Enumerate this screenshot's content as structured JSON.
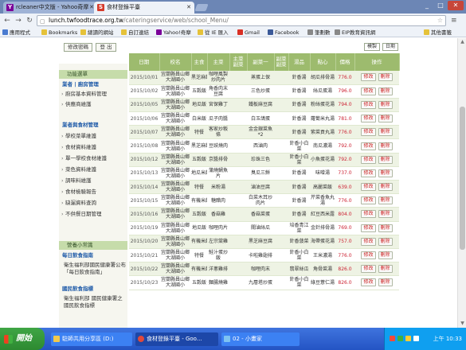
{
  "browser": {
    "tabs": [
      {
        "label": "rcleaner中文版 - Yahoo奇摩",
        "favicon": "Y"
      },
      {
        "label": "食材登錄平臺",
        "favicon": "S"
      }
    ],
    "url_host": "lunch.twfoodtrace.org.tw",
    "url_path": "/cateringservice/web/school_Menu/",
    "bookmarks": [
      "應用程式",
      "Bookmarks",
      "總讀的網站",
      "自訂連結",
      "Yahoo!奇摩",
      "從 IE 匯入",
      "Gmail",
      "Facebook",
      "筆劃數",
      "EIP教育資訊網",
      "其他書籤"
    ]
  },
  "page": {
    "top_buttons": [
      "修改密碼",
      "登 出"
    ],
    "table_buttons": [
      "模製",
      "日期"
    ],
    "sidebar": {
      "header": "功能選單",
      "cat1": "業者 | 廚房管理",
      "cat1_items": [
        "廚房基本資料管理",
        "供應商維護"
      ],
      "cat2": "業者與食材管理",
      "cat2_items": [
        "學校菜單維護",
        "食材資料維護",
        "單一學校食材維護",
        "菜色資料維護",
        "調味料維護",
        "食材檢驗報告",
        "缺漏資料查詢",
        "不供餐日期管理"
      ],
      "tips_header": "營養小常識",
      "tip1_title": "每日飲食指南",
      "tip1_text": "衛生福利部國民健康署公布「每日飲食指南」",
      "tip2_title": "國民飲食指標",
      "tip2_text": "衛生福利部 國民健康署之國民飲食指標"
    },
    "table": {
      "headers": [
        "日期",
        "校名",
        "主食",
        "主菜",
        "主菜 副菜",
        "副菜一",
        "副菜 副菜",
        "湯品",
        "點心",
        "價格",
        "操作"
      ],
      "rows": [
        [
          "2015/10/01",
          "宜蘭縣員山鄉大湖國小",
          "黑芝麻飯",
          "咖哩風製炒肉片",
          "",
          "蒸蛋上保",
          "",
          "針香湯",
          "胡瓜排骨湯",
          "776.0"
        ],
        [
          "2015/10/02",
          "宜蘭縣員山鄉大湖國小",
          "五穀飯",
          "角香肉末豆腐",
          "",
          "三色炒蛋",
          "",
          "針香湯",
          "絲瓜蛋湯",
          "796.0"
        ],
        [
          "2015/10/05",
          "宜蘭縣員山鄉大湖國小",
          "地瓜飯",
          "宮保雞丁",
          "",
          "鐵板麻豆腐",
          "",
          "針香湯",
          "粉絲蛋花湯",
          "794.0"
        ],
        [
          "2015/10/06",
          "宜蘭縣員山鄉大湖國小",
          "白米飯",
          "瓜子肉醬",
          "",
          "白玉鴿蛋",
          "",
          "針香湯",
          "蘿蔔米丸湯",
          "781.0"
        ],
        [
          "2015/10/07",
          "宜蘭縣員山鄉大湖國小",
          "特餐",
          "客家炒粄條",
          "",
          "金金銀菜魚*2",
          "",
          "針香湯",
          "紫菜貢丸湯",
          "776.0"
        ],
        [
          "2015/10/08",
          "宜蘭縣員山鄉大湖國小",
          "黑芝麻飯",
          "豆豉燒肉",
          "",
          "西滷肉",
          "",
          "針香小白菜",
          "南瓜濃湯",
          "792.0"
        ],
        [
          "2015/10/12",
          "宜蘭縣員山鄉大湖國小",
          "五穀飯",
          "京醬排骨",
          "",
          "珍珠三色",
          "",
          "針香小白菜",
          "小魚蛋花湯",
          "792.0"
        ],
        [
          "2015/10/13",
          "宜蘭縣員山鄉大湖國小",
          "地瓜米飯",
          "蒲燒鯛魚片",
          "",
          "臭瓜三鮮",
          "",
          "針香湯",
          "味噌湯",
          "737.0"
        ],
        [
          "2015/10/14",
          "宜蘭縣員山鄉大湖國小",
          "特餐",
          "米粉湯",
          "",
          "滷油豆腐",
          "",
          "針香湯",
          "高麗菜飯",
          "639.0"
        ],
        [
          "2015/10/15",
          "宜蘭縣員山鄉大湖國小",
          "有機米飯",
          "糖醋肉",
          "",
          "白菜木耳炒肉片",
          "",
          "針香湯",
          "芹菜香魚丸湯",
          "776.0"
        ],
        [
          "2015/10/16",
          "宜蘭縣員山鄉大湖國小",
          "五穀飯",
          "香菇雞",
          "",
          "香菇菜蛋",
          "",
          "針香湯",
          "紅豆西米露",
          "804.0"
        ],
        [
          "2015/10/19",
          "宜蘭縣員山鄉大湖國小",
          "地瓜飯",
          "咖哩肉片",
          "",
          "關滷絲瓜",
          "",
          "培香青江菜",
          "金針排骨湯",
          "769.0"
        ],
        [
          "2015/10/20",
          "宜蘭縣員山鄉大湖國小",
          "有機米飯",
          "左宗棠雞",
          "",
          "黑芝麻豆腐",
          "",
          "針香菠菜",
          "海帶蛋花湯",
          "757.0"
        ],
        [
          "2015/10/21",
          "宜蘭縣員山鄉大湖國小",
          "特餐",
          "鮭汁蛋炒飯",
          "",
          "卡啦雞翅排",
          "",
          "針香小白菜",
          "王米濃湯",
          "776.0"
        ],
        [
          "2015/10/22",
          "宜蘭縣員山鄉大湖國小",
          "有機米飯",
          "洋蔥雞排",
          "",
          "咖哩肉末",
          "",
          "翡翠絲瓜",
          "角骨菜湯",
          "826.0"
        ],
        [
          "2015/10/23",
          "宜蘭縣員山鄉大湖國小",
          "五穀飯",
          "麵腸燒雞",
          "",
          "九層塔炒蛋",
          "",
          "針香小白菜",
          "綠豆薏仁湯",
          "826.0"
        ]
      ],
      "edit_label": "修改",
      "delete_label": "刪除"
    }
  },
  "taskbar": {
    "start": "開始",
    "tasks": [
      "駐師共用分享區 (D:)",
      "食材登錄平臺 - Goo...",
      "02 - 小畫家"
    ],
    "clock": "上午 10:33"
  }
}
